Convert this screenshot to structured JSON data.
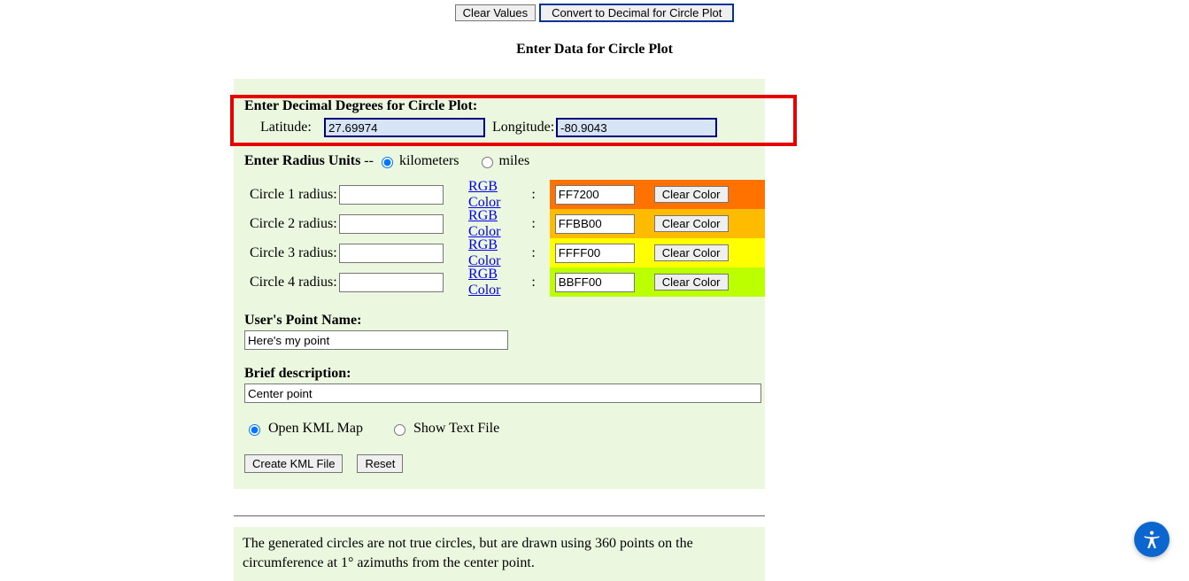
{
  "top": {
    "clear_label": "Clear Values",
    "convert_label": "Convert to Decimal for Circle Plot"
  },
  "title": "Enter Data for Circle Plot",
  "dd": {
    "heading": "Enter Decimal Degrees for Circle Plot:",
    "lat_label": "Latitude:",
    "lon_label": "Longitude:",
    "lat_value": "27.69974",
    "lon_value": "-80.9043"
  },
  "units": {
    "label_prefix": "Enter Radius Units",
    "dash": " -- ",
    "km_label": "kilometers",
    "miles_label": "miles",
    "km_checked": true,
    "miles_checked": false
  },
  "circles": [
    {
      "label": "Circle 1 radius:",
      "radius": "",
      "rgb_link": "RGB Color",
      "color": "FF7200",
      "bg": "#FF7200",
      "clear_label": "Clear Color"
    },
    {
      "label": "Circle 2 radius:",
      "radius": "",
      "rgb_link": "RGB Color",
      "color": "FFBB00",
      "bg": "#FFBB00",
      "clear_label": "Clear Color"
    },
    {
      "label": "Circle 3 radius:",
      "radius": "",
      "rgb_link": "RGB Color",
      "color": "FFFF00",
      "bg": "#FFFF00",
      "clear_label": "Clear Color"
    },
    {
      "label": "Circle 4 radius:",
      "radius": "",
      "rgb_link": "RGB Color",
      "color": "BBFF00",
      "bg": "#BBFF00",
      "clear_label": "Clear Color"
    }
  ],
  "point_name": {
    "heading": "User's Point Name:",
    "value": "Here's my point"
  },
  "description": {
    "heading": "Brief description:",
    "value": "Center point"
  },
  "output": {
    "open_kml_label": "Open KML Map",
    "show_text_label": "Show Text File",
    "open_kml_checked": true,
    "show_text_checked": false
  },
  "actions": {
    "create_label": "Create KML File",
    "reset_label": "Reset"
  },
  "note": "The generated circles are not true circles, but are drawn using 360 points on the circumference at 1° azimuths from the center point."
}
